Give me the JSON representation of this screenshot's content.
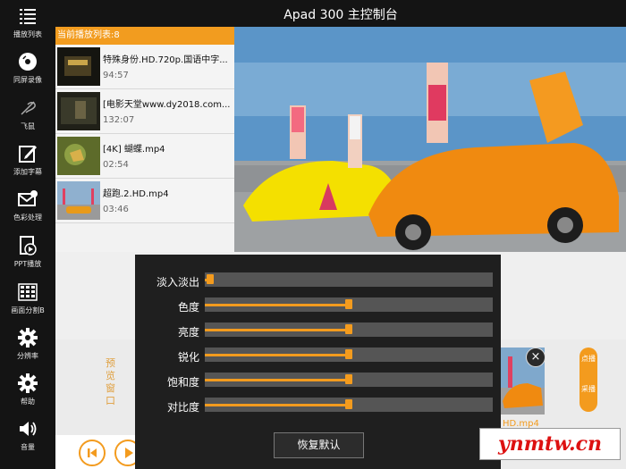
{
  "app": {
    "title": "Apad 300 主控制台"
  },
  "sidebar": {
    "items": [
      {
        "label": "播放列表",
        "icon": "list-icon"
      },
      {
        "label": "同屏录像",
        "icon": "disc-icon"
      },
      {
        "label": "飞鼠",
        "icon": "air-mouse-icon"
      },
      {
        "label": "添加字幕",
        "icon": "edit-icon"
      },
      {
        "label": "色彩处理",
        "icon": "mail-color-icon"
      },
      {
        "label": "PPT播放",
        "icon": "ppt-icon"
      },
      {
        "label": "画面分割B",
        "icon": "grid-icon"
      },
      {
        "label": "分辨率",
        "icon": "gear-icon"
      },
      {
        "label": "帮助",
        "icon": "gear-help-icon"
      },
      {
        "label": "音量",
        "icon": "speaker-icon"
      }
    ]
  },
  "playlist": {
    "header": "当前播放列表:8",
    "items": [
      {
        "title": "特殊身份.HD.720p.国语中字...",
        "duration": "94:57"
      },
      {
        "title": "[电影天堂www.dy2018.com...",
        "duration": "132:07"
      },
      {
        "title": "[4K] 蝴蝶.mp4",
        "duration": "02:54"
      },
      {
        "title": "超跑.2.HD.mp4",
        "duration": "03:46"
      }
    ]
  },
  "color_panel": {
    "sliders": [
      {
        "label": "淡入淡出",
        "value": 0.02
      },
      {
        "label": "色度",
        "value": 0.5
      },
      {
        "label": "亮度",
        "value": 0.5
      },
      {
        "label": "锐化",
        "value": 0.5
      },
      {
        "label": "饱和度",
        "value": 0.5
      },
      {
        "label": "对比度",
        "value": 0.5
      }
    ],
    "reset_label": "恢复默认"
  },
  "preview": {
    "label": "预览窗口"
  },
  "right_panel": {
    "thumb_caption": "HD.mp4",
    "close_glyph": "×",
    "pill_top": "点播",
    "pill_bottom": "采播"
  },
  "watermark": "ynmtw.cn",
  "colors": {
    "accent": "#f39b1e",
    "sidebar": "#141414",
    "panel": "#1f1f1f"
  }
}
